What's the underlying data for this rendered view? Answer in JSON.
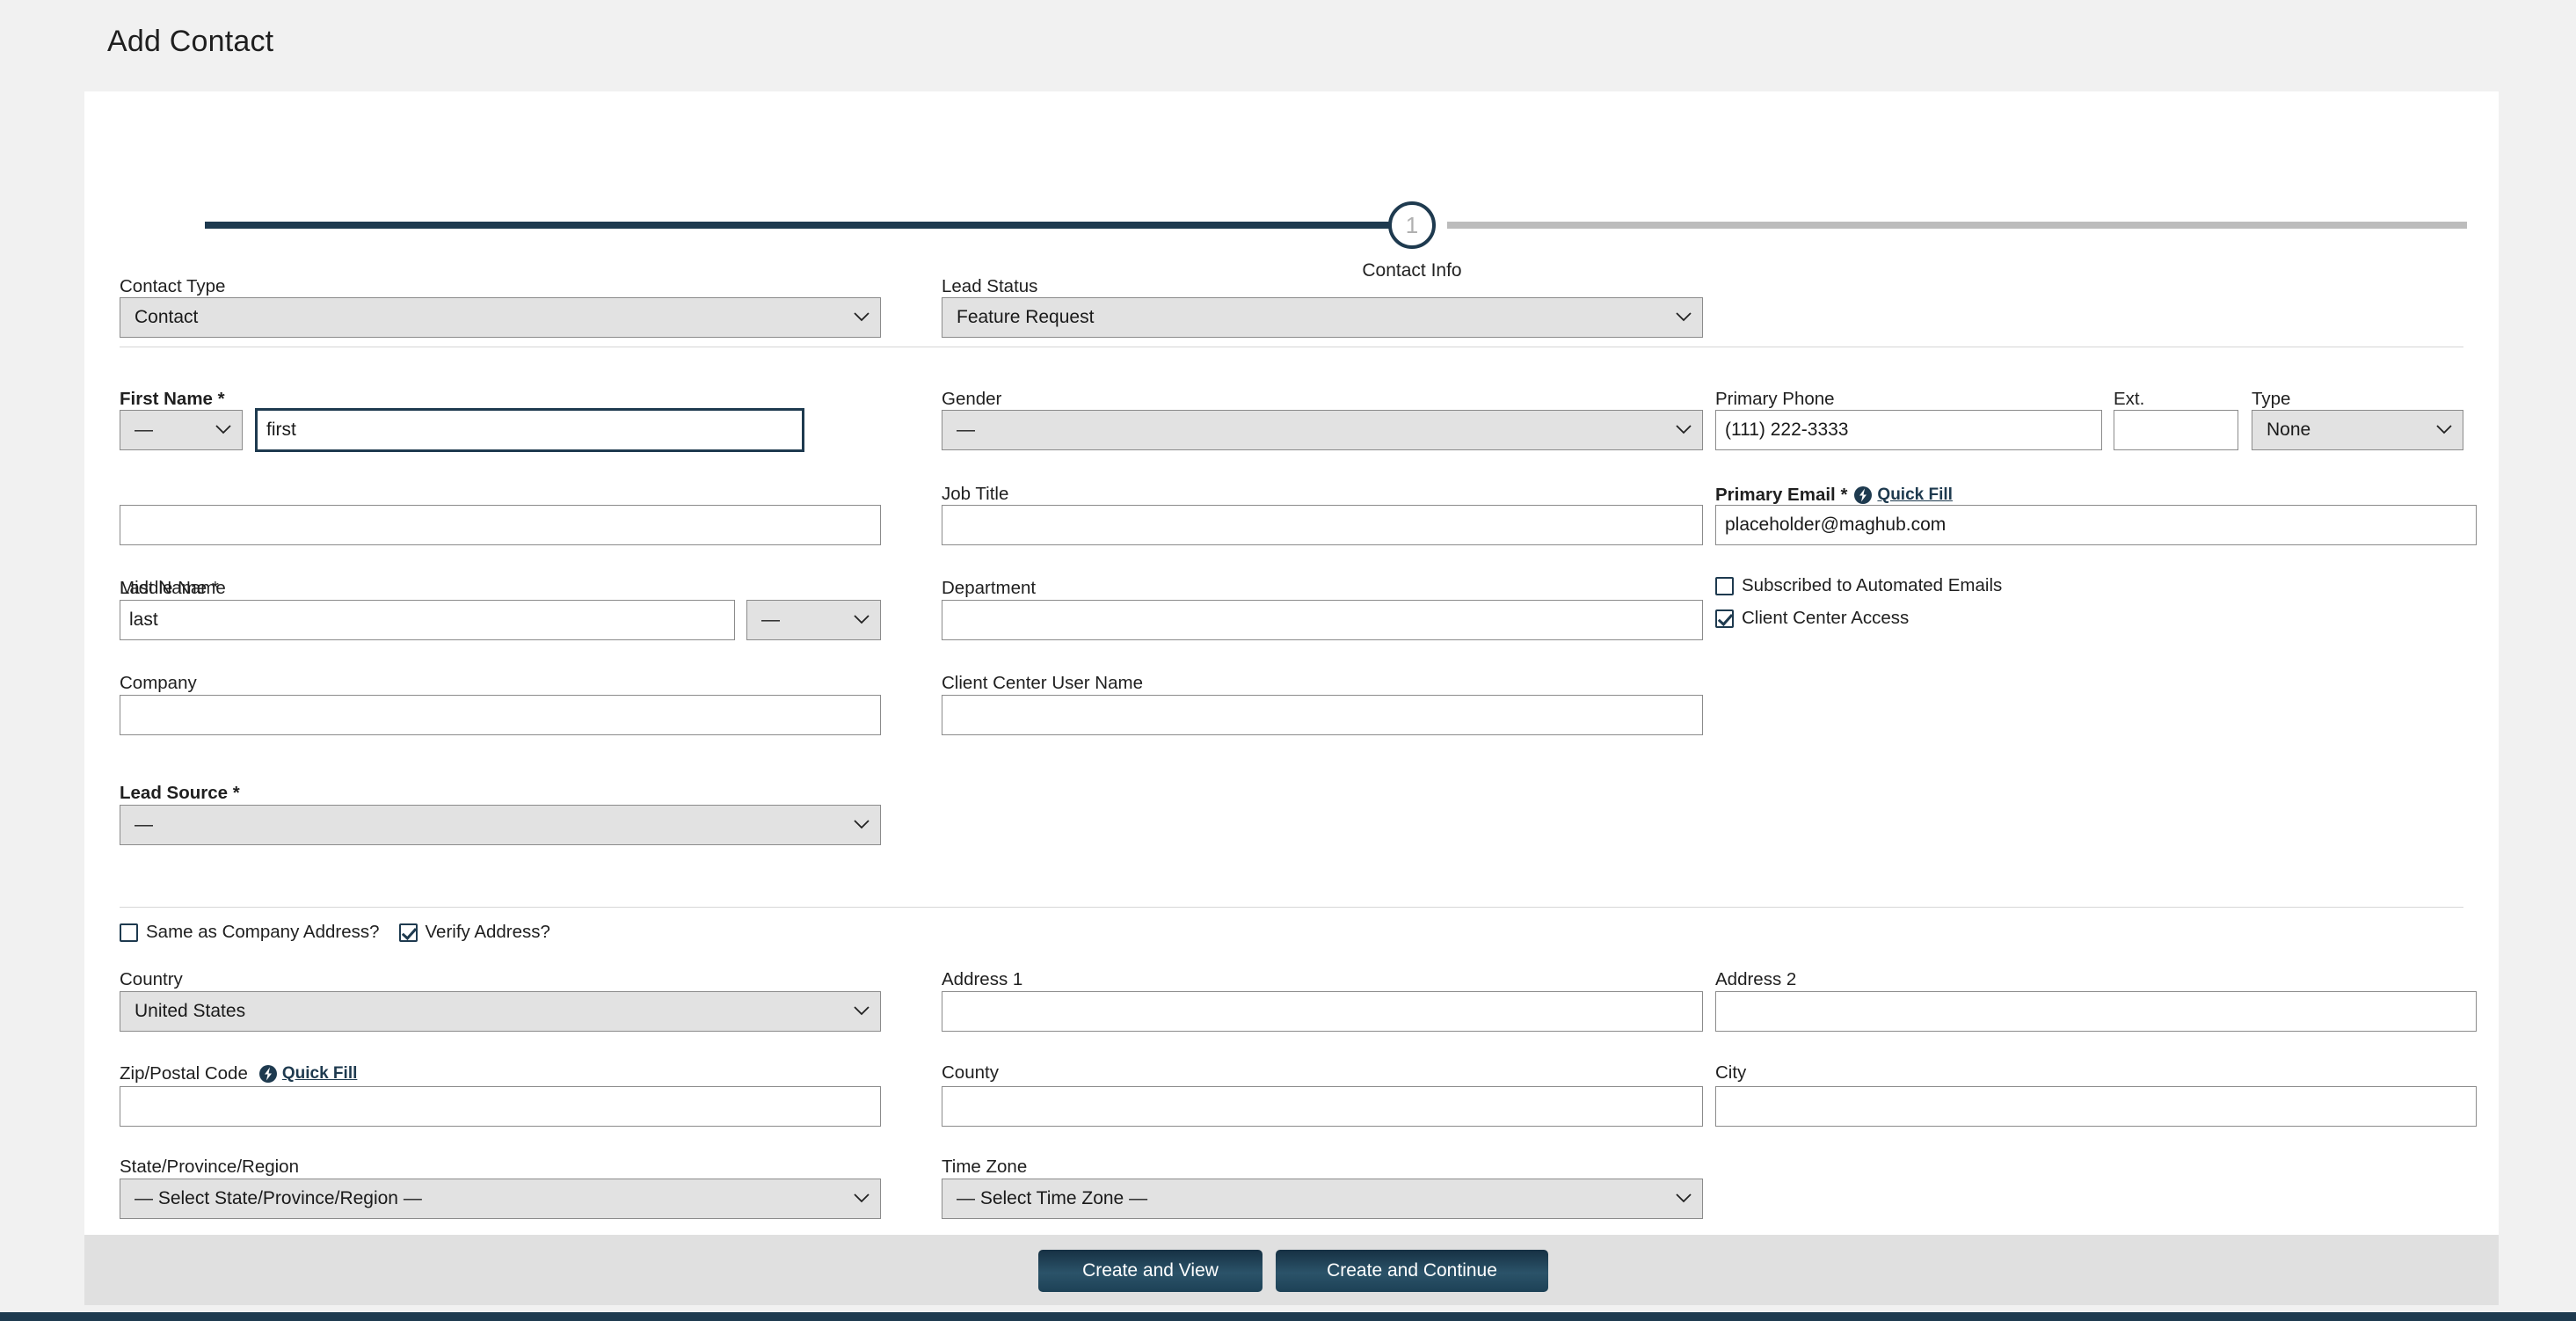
{
  "page": {
    "title": "Add Contact"
  },
  "stepper": {
    "step_number": "1",
    "step_label": "Contact Info",
    "progress_percent": 50
  },
  "section_top": {
    "contact_type": {
      "label": "Contact Type",
      "value": "Contact"
    },
    "lead_status": {
      "label": "Lead Status",
      "value": "Feature Request"
    }
  },
  "section_name": {
    "first_name": {
      "label": "First Name *",
      "prefix_value": "—",
      "value": "first",
      "focused": true
    },
    "middle_name": {
      "label": "Middle Name",
      "value": ""
    },
    "last_name": {
      "label": "Last Name *",
      "value": "last",
      "suffix_value": "—"
    },
    "company": {
      "label": "Company",
      "value": ""
    },
    "lead_source": {
      "label": "Lead Source *",
      "value": "—"
    },
    "gender": {
      "label": "Gender",
      "value": "—"
    },
    "job_title": {
      "label": "Job Title",
      "value": ""
    },
    "department": {
      "label": "Department",
      "value": ""
    },
    "client_center_user_name": {
      "label": "Client Center User Name",
      "value": ""
    },
    "primary_phone": {
      "label": "Primary Phone",
      "value": "(111) 222-3333"
    },
    "ext": {
      "label": "Ext.",
      "value": ""
    },
    "phone_type": {
      "label": "Type",
      "value": "None"
    },
    "primary_email": {
      "label": "Primary Email *",
      "quick_fill": "Quick Fill",
      "value": "placeholder@maghub.com"
    },
    "subscribed_checkbox": {
      "label": "Subscribed to Automated Emails",
      "checked": false
    },
    "client_center_checkbox": {
      "label": "Client Center Access",
      "checked": true
    }
  },
  "section_address": {
    "same_as_company": {
      "label": "Same as Company Address?",
      "checked": false
    },
    "verify_address": {
      "label": "Verify Address?",
      "checked": true
    },
    "country": {
      "label": "Country",
      "value": "United States"
    },
    "address1": {
      "label": "Address 1",
      "value": ""
    },
    "address2": {
      "label": "Address 2",
      "value": ""
    },
    "zip": {
      "label": "Zip/Postal Code",
      "quick_fill": "Quick Fill",
      "value": ""
    },
    "county": {
      "label": "County",
      "value": ""
    },
    "city": {
      "label": "City",
      "value": ""
    },
    "state": {
      "label": "State/Province/Region",
      "value": "— Select State/Province/Region —"
    },
    "timezone": {
      "label": "Time Zone",
      "value": "— Select Time Zone —"
    }
  },
  "footer": {
    "create_and_view": "Create and View",
    "create_and_continue": "Create and Continue"
  },
  "colors": {
    "accent_navy": "#1e3a4f",
    "page_background": "#f1f1f1",
    "card_background": "#ffffff",
    "select_background": "#e2e2e2",
    "footer_background": "#e0e0e0",
    "track_incomplete": "#bcbcbc"
  }
}
